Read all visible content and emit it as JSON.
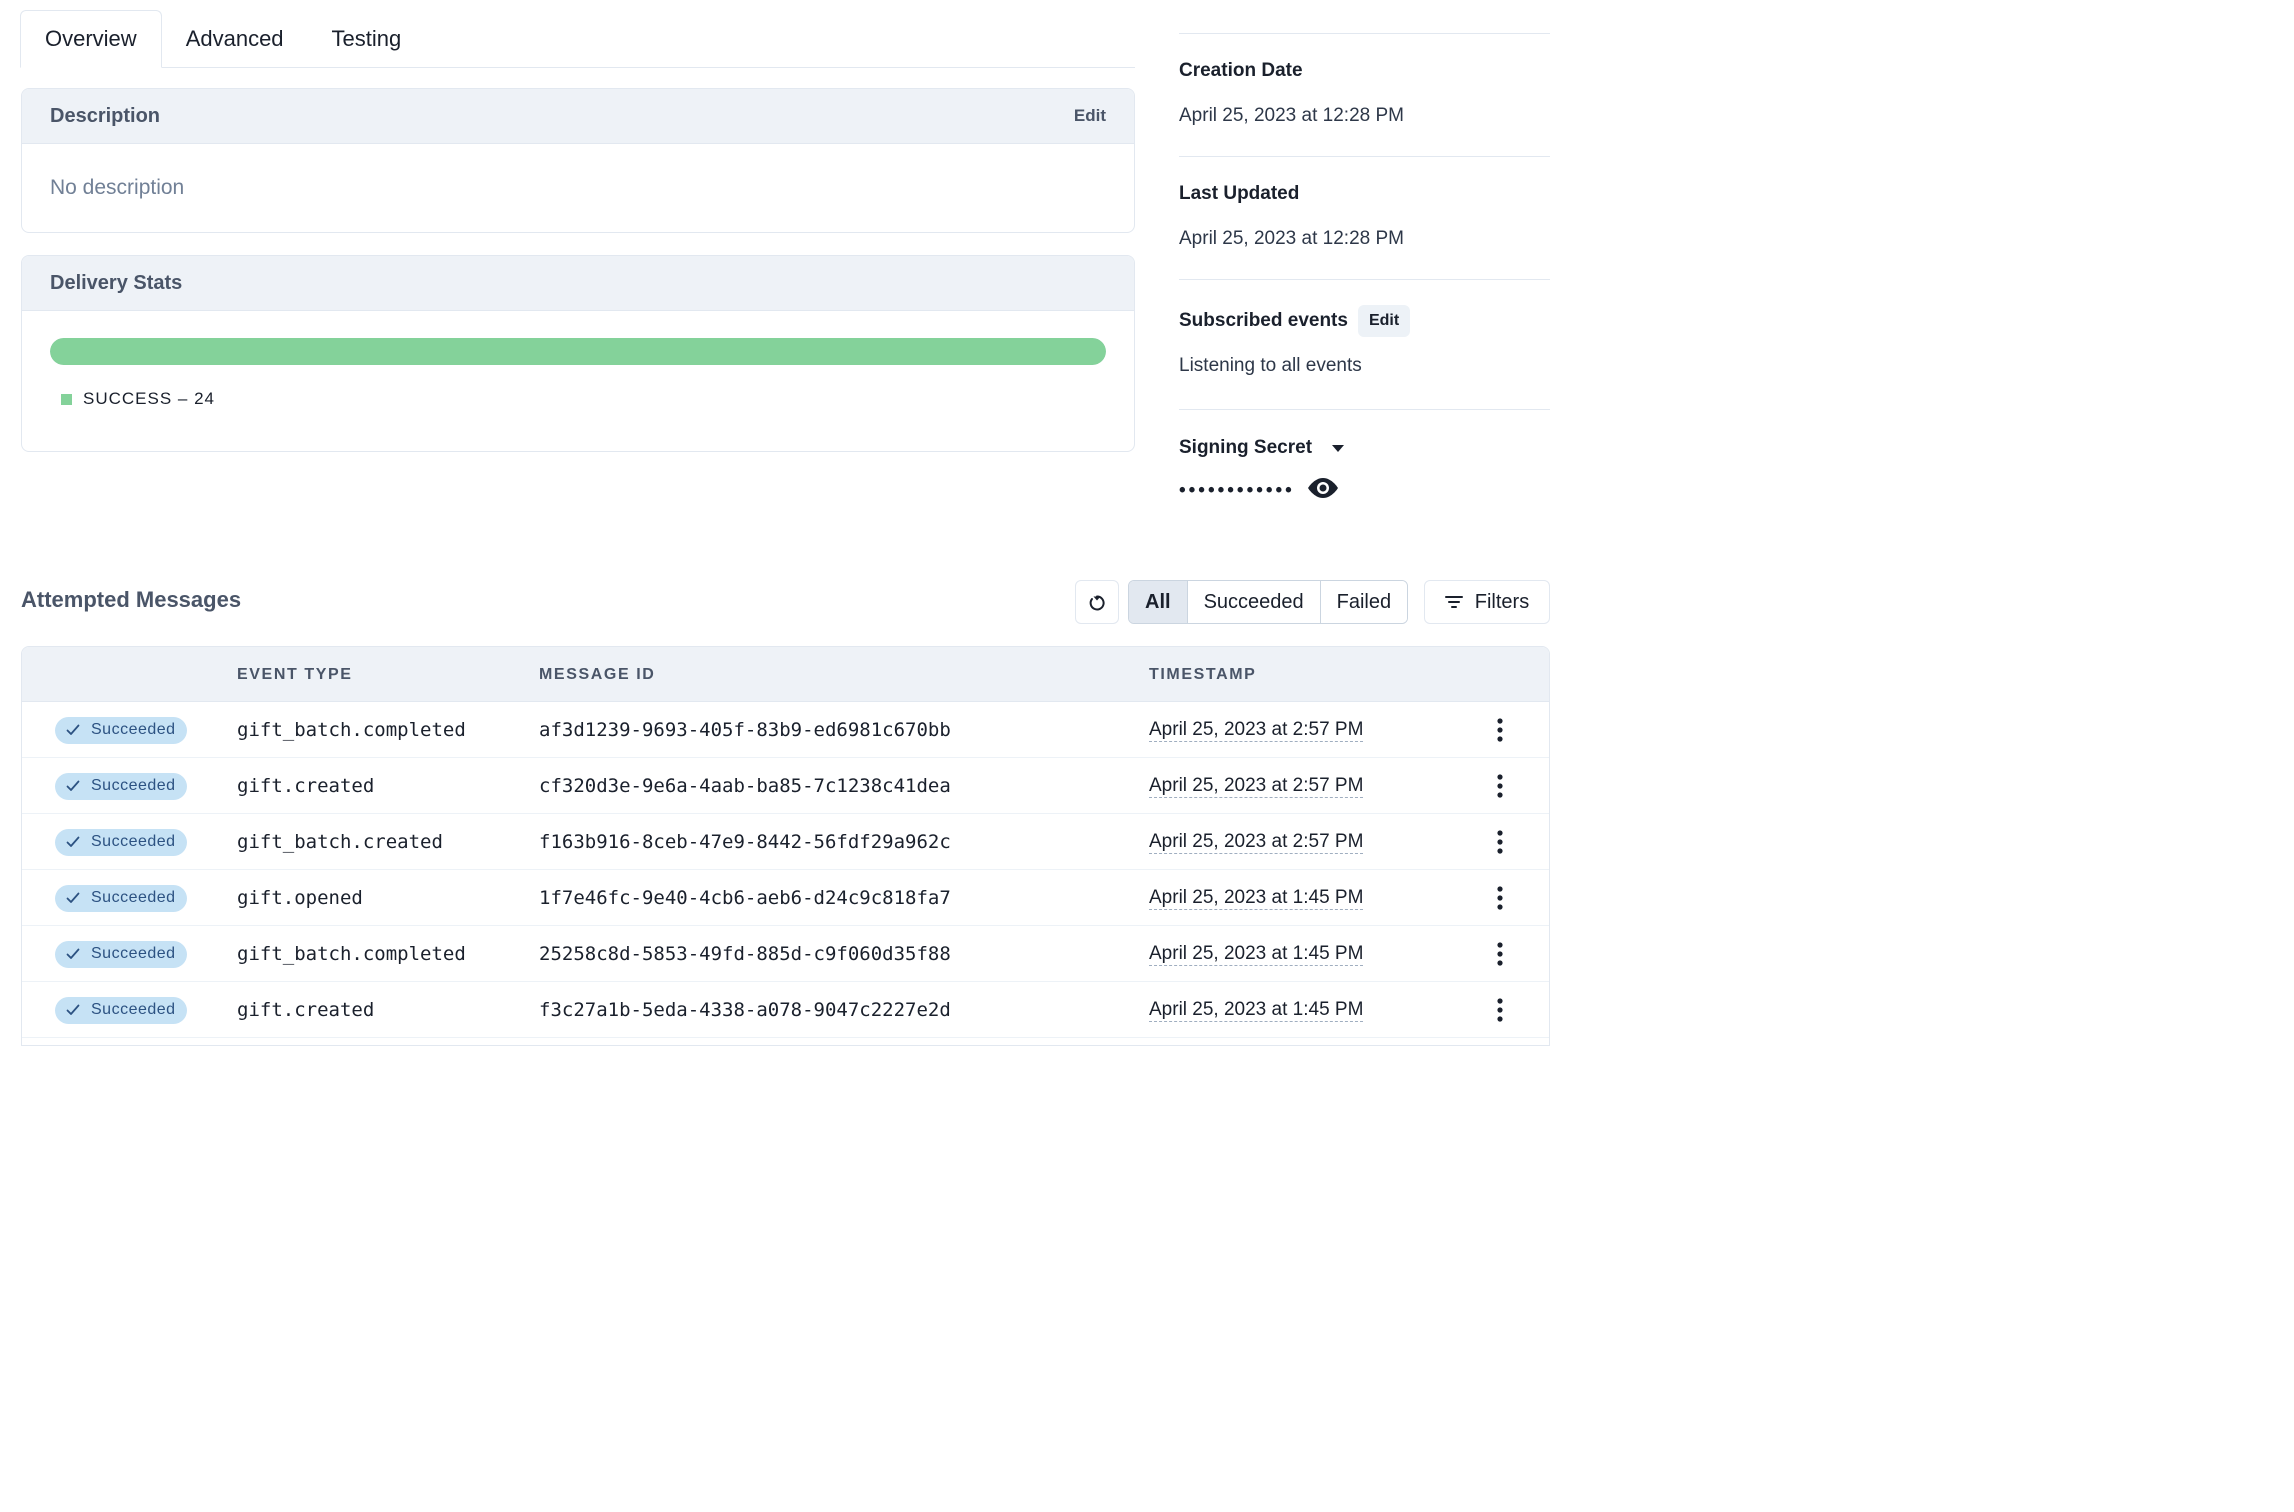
{
  "tabs": [
    {
      "label": "Overview",
      "active": true
    },
    {
      "label": "Advanced",
      "active": false
    },
    {
      "label": "Testing",
      "active": false
    }
  ],
  "description": {
    "title": "Description",
    "edit_label": "Edit",
    "body": "No description"
  },
  "delivery_stats": {
    "title": "Delivery Stats",
    "success_fraction": 1.0,
    "legend_label": "SUCCESS – 24",
    "bar_color": "#84d29a"
  },
  "side": {
    "creation_label": "Creation Date",
    "creation_value": "April 25, 2023 at 12:28 PM",
    "updated_label": "Last Updated",
    "updated_value": "April 25, 2023 at 12:28 PM",
    "events_label": "Subscribed events",
    "events_edit_label": "Edit",
    "events_value": "Listening to all events",
    "secret_label": "Signing Secret",
    "secret_masked": "••••••••••••",
    "secret_icon": "eye-icon"
  },
  "messages": {
    "title": "Attempted Messages",
    "filters": [
      "All",
      "Succeeded",
      "Failed"
    ],
    "active_filter": "All",
    "filters_button_label": "Filters",
    "columns": {
      "event_type": "EVENT TYPE",
      "message_id": "MESSAGE ID",
      "timestamp": "TIMESTAMP"
    },
    "rows": [
      {
        "status": "Succeeded",
        "event_type": "gift_batch.completed",
        "message_id": "af3d1239-9693-405f-83b9-ed6981c670bb",
        "timestamp": "April 25, 2023 at 2:57 PM"
      },
      {
        "status": "Succeeded",
        "event_type": "gift.created",
        "message_id": "cf320d3e-9e6a-4aab-ba85-7c1238c41dea",
        "timestamp": "April 25, 2023 at 2:57 PM"
      },
      {
        "status": "Succeeded",
        "event_type": "gift_batch.created",
        "message_id": "f163b916-8ceb-47e9-8442-56fdf29a962c",
        "timestamp": "April 25, 2023 at 2:57 PM"
      },
      {
        "status": "Succeeded",
        "event_type": "gift.opened",
        "message_id": "1f7e46fc-9e40-4cb6-aeb6-d24c9c818fa7",
        "timestamp": "April 25, 2023 at 1:45 PM"
      },
      {
        "status": "Succeeded",
        "event_type": "gift_batch.completed",
        "message_id": "25258c8d-5853-49fd-885d-c9f060d35f88",
        "timestamp": "April 25, 2023 at 1:45 PM"
      },
      {
        "status": "Succeeded",
        "event_type": "gift.created",
        "message_id": "f3c27a1b-5eda-4338-a078-9047c2227e2d",
        "timestamp": "April 25, 2023 at 1:45 PM"
      }
    ]
  }
}
